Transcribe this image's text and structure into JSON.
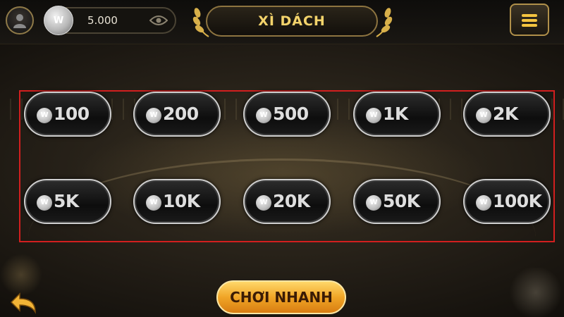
{
  "header": {
    "balance": "5.000",
    "coin_symbol": "W",
    "title": "XÌ DÁCH"
  },
  "bet_options": [
    {
      "label": "100"
    },
    {
      "label": "200"
    },
    {
      "label": "500"
    },
    {
      "label": "1K"
    },
    {
      "label": "2K"
    },
    {
      "label": "5K"
    },
    {
      "label": "10K"
    },
    {
      "label": "20K"
    },
    {
      "label": "50K"
    },
    {
      "label": "100K"
    }
  ],
  "footer": {
    "quick_play_label": "CHƠI NHANH"
  },
  "colors": {
    "accent_gold": "#f3d36b",
    "quick_play": "#f0a526",
    "highlight_frame": "#d21f1f"
  }
}
